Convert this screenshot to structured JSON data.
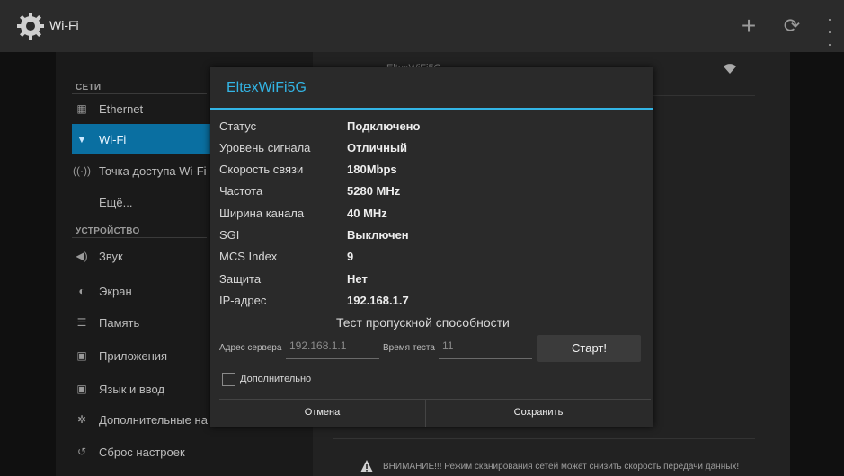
{
  "actionbar": {
    "title": "Wi-Fi",
    "icons": {
      "settings": "gear-icon",
      "add": "plus-icon",
      "refresh": "refresh-icon",
      "overflow": "overflow-menu-icon"
    }
  },
  "sidebar": {
    "section_networks": "СЕТИ",
    "section_device": "УСТРОЙСТВО",
    "items": [
      {
        "label": "Ethernet",
        "icon": "ethernet-icon"
      },
      {
        "label": "Wi-Fi",
        "icon": "wifi-icon",
        "selected": true
      },
      {
        "label": "Точка доступа Wi-Fi",
        "icon": "hotspot-icon"
      },
      {
        "label": "Ещё...",
        "icon": ""
      },
      {
        "label": "Звук",
        "icon": "sound-icon"
      },
      {
        "label": "Экран",
        "icon": "screen-icon"
      },
      {
        "label": "Память",
        "icon": "storage-icon"
      },
      {
        "label": "Приложения",
        "icon": "apps-icon"
      },
      {
        "label": "Язык и ввод",
        "icon": "language-icon"
      },
      {
        "label": "Дополнительные на",
        "icon": "advanced-settings-icon"
      },
      {
        "label": "Сброс настроек",
        "icon": "reset-icon"
      }
    ]
  },
  "wifi_list": {
    "first_ssid": "EltexWiFi5G",
    "warning": "ВНИМАНИЕ!!! Режим сканирования сетей может снизить скорость передачи данных!"
  },
  "dialog": {
    "title": "EltexWiFi5G",
    "rows": [
      {
        "label": "Статус",
        "value": "Подключено"
      },
      {
        "label": "Уровень сигнала",
        "value": "Отличный"
      },
      {
        "label": "Скорость связи",
        "value": "180Mbps"
      },
      {
        "label": "Частота",
        "value": "5280 MHz"
      },
      {
        "label": "Ширина канала",
        "value": "40 MHz"
      },
      {
        "label": "SGI",
        "value": "Выключен"
      },
      {
        "label": "MCS Index",
        "value": "9"
      },
      {
        "label": "Защита",
        "value": "Нет"
      },
      {
        "label": "IP-адрес",
        "value": "192.168.1.7"
      }
    ],
    "bandwidth_test": {
      "title": "Тест пропускной способности",
      "server_label": "Адрес сервера",
      "server_placeholder": "192.168.1.1",
      "time_label": "Время теста",
      "time_placeholder": "11",
      "start_label": "Старт!"
    },
    "advanced_label": "Дополнительно",
    "advanced_checked": false,
    "cancel_label": "Отмена",
    "save_label": "Сохранить"
  },
  "colors": {
    "accent": "#33b5e5",
    "selected_bg": "#0a6fa1"
  }
}
